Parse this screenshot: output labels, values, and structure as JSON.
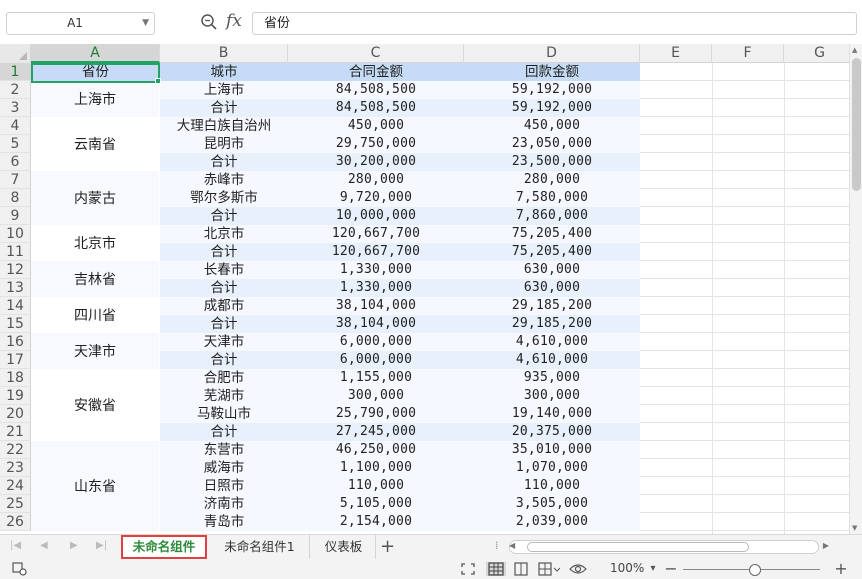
{
  "formula_bar": {
    "name_box": "A1",
    "formula": "省份"
  },
  "columns": [
    "A",
    "B",
    "C",
    "D",
    "E",
    "F",
    "G"
  ],
  "rows": [
    "1",
    "2",
    "3",
    "4",
    "5",
    "6",
    "7",
    "8",
    "9",
    "10",
    "11",
    "12",
    "13",
    "14",
    "15",
    "16",
    "17",
    "18",
    "19",
    "20",
    "21",
    "22",
    "23",
    "24",
    "25",
    "26"
  ],
  "table": {
    "headers": [
      "省份",
      "城市",
      "合同金额",
      "回款金额"
    ],
    "provinces": [
      {
        "name": "上海市",
        "first_row": 2,
        "span": 2
      },
      {
        "name": "云南省",
        "first_row": 4,
        "span": 3
      },
      {
        "name": "内蒙古",
        "first_row": 7,
        "span": 3
      },
      {
        "name": "北京市",
        "first_row": 10,
        "span": 2
      },
      {
        "name": "吉林省",
        "first_row": 12,
        "span": 2
      },
      {
        "name": "四川省",
        "first_row": 14,
        "span": 2
      },
      {
        "name": "天津市",
        "first_row": 16,
        "span": 2
      },
      {
        "name": "安徽省",
        "first_row": 18,
        "span": 4
      },
      {
        "name": "山东省",
        "first_row": 22,
        "span": 5
      }
    ],
    "rows": [
      {
        "city": "上海市",
        "contract": "84,508,500",
        "payment": "59,192,000"
      },
      {
        "city": "合计",
        "contract": "84,508,500",
        "payment": "59,192,000"
      },
      {
        "city": "大理白族自治州",
        "contract": "450,000",
        "payment": "450,000"
      },
      {
        "city": "昆明市",
        "contract": "29,750,000",
        "payment": "23,050,000"
      },
      {
        "city": "合计",
        "contract": "30,200,000",
        "payment": "23,500,000"
      },
      {
        "city": "赤峰市",
        "contract": "280,000",
        "payment": "280,000"
      },
      {
        "city": "鄂尔多斯市",
        "contract": "9,720,000",
        "payment": "7,580,000"
      },
      {
        "city": "合计",
        "contract": "10,000,000",
        "payment": "7,860,000"
      },
      {
        "city": "北京市",
        "contract": "120,667,700",
        "payment": "75,205,400"
      },
      {
        "city": "合计",
        "contract": "120,667,700",
        "payment": "75,205,400"
      },
      {
        "city": "长春市",
        "contract": "1,330,000",
        "payment": "630,000"
      },
      {
        "city": "合计",
        "contract": "1,330,000",
        "payment": "630,000"
      },
      {
        "city": "成都市",
        "contract": "38,104,000",
        "payment": "29,185,200"
      },
      {
        "city": "合计",
        "contract": "38,104,000",
        "payment": "29,185,200"
      },
      {
        "city": "天津市",
        "contract": "6,000,000",
        "payment": "4,610,000"
      },
      {
        "city": "合计",
        "contract": "6,000,000",
        "payment": "4,610,000"
      },
      {
        "city": "合肥市",
        "contract": "1,155,000",
        "payment": "935,000"
      },
      {
        "city": "芜湖市",
        "contract": "300,000",
        "payment": "300,000"
      },
      {
        "city": "马鞍山市",
        "contract": "25,790,000",
        "payment": "19,140,000"
      },
      {
        "city": "合计",
        "contract": "27,245,000",
        "payment": "20,375,000"
      },
      {
        "city": "东营市",
        "contract": "46,250,000",
        "payment": "35,010,000"
      },
      {
        "city": "威海市",
        "contract": "1,100,000",
        "payment": "1,070,000"
      },
      {
        "city": "日照市",
        "contract": "110,000",
        "payment": "110,000"
      },
      {
        "city": "济南市",
        "contract": "5,105,000",
        "payment": "3,505,000"
      },
      {
        "city": "青岛市",
        "contract": "2,154,000",
        "payment": "2,039,000"
      }
    ]
  },
  "sheet_tabs": [
    {
      "label": "未命名组件",
      "active": true
    },
    {
      "label": "未命名组件1",
      "active": false
    },
    {
      "label": "仪表板",
      "active": false
    }
  ],
  "add_sheet_label": "+",
  "status_bar": {
    "zoom": "100%",
    "zoom_level_percent": 100
  },
  "colors": {
    "accent_green": "#21a366",
    "header_band": "#c6dcf6",
    "active_tab_border": "#e04040"
  },
  "icons": [
    "zoom-icon",
    "fx-icon",
    "macro-icon",
    "fullscreen-icon",
    "normal-view-icon",
    "page-layout-icon",
    "split-icon",
    "eye-icon"
  ]
}
